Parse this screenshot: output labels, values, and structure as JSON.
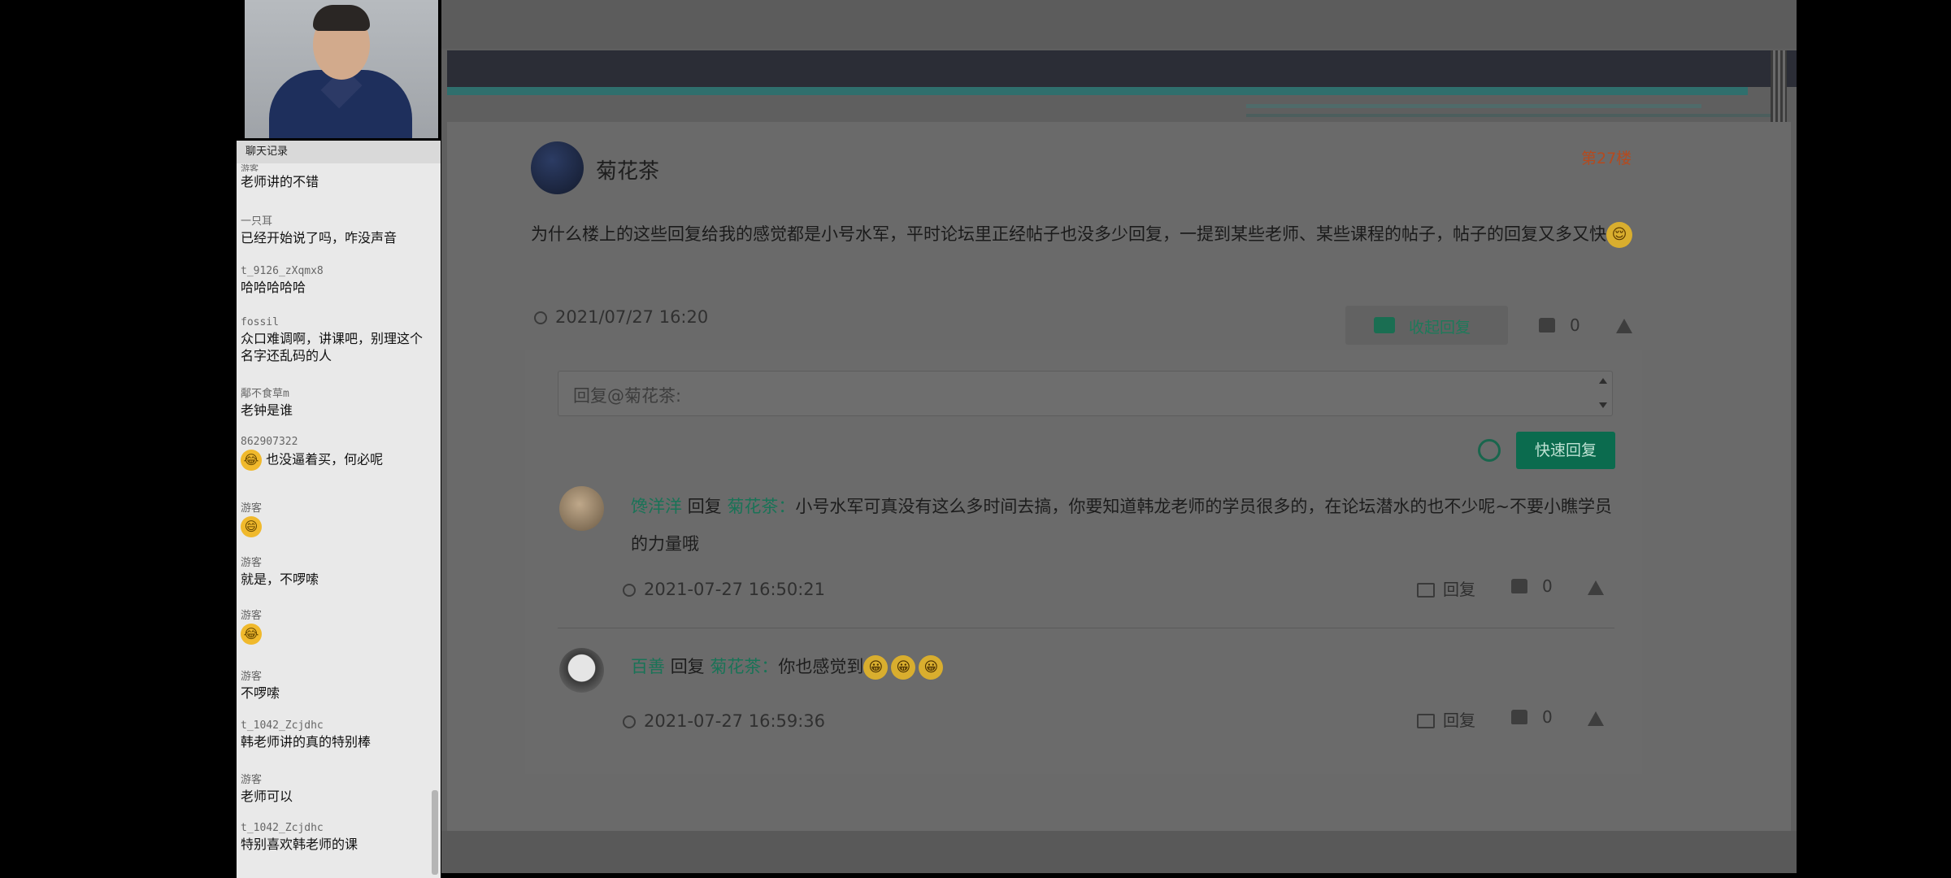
{
  "chat": {
    "title": "聊天记录",
    "messages": [
      {
        "user": "游客",
        "text": "老师讲的不错"
      },
      {
        "user": "一只耳",
        "text": "已经开始说了吗，咋没声音"
      },
      {
        "user": "t_9126_zXqmx8",
        "text": "哈哈哈哈哈"
      },
      {
        "user": "fossil",
        "text": "众口难调啊，讲课吧，别理这个名字还乱码的人"
      },
      {
        "user": "鄅不食草m",
        "text": "老钟是谁"
      },
      {
        "user": "862907322",
        "text": "也没逼着买，何必呢",
        "emoji": "😂"
      },
      {
        "user": "游客",
        "text": "",
        "emoji": "😄"
      },
      {
        "user": "游客",
        "text": "就是，不啰嗦"
      },
      {
        "user": "游客",
        "text": "",
        "emoji": "😂"
      },
      {
        "user": "游客",
        "text": "不啰嗦"
      },
      {
        "user": "t_1042_Zcjdhc",
        "text": "韩老师讲的真的特别棒"
      },
      {
        "user": "游客",
        "text": "老师可以"
      },
      {
        "user": "t_1042_Zcjdhc",
        "text": "特别喜欢韩老师的课"
      }
    ]
  },
  "post": {
    "author": "菊花茶",
    "floor": "第27楼",
    "body": "为什么楼上的这些回复给我的感觉都是小号水军，平时论坛里正经帖子也没多少回复，一提到某些老师、某些课程的帖子，帖子的回复又多又快",
    "body_emoji": "😌",
    "time": "2021/07/27 16:20",
    "collapse_label": "收起回复",
    "likes": "0"
  },
  "reply_box": {
    "placeholder": "回复@菊花茶:",
    "quick_reply_label": "快速回复"
  },
  "replies": [
    {
      "user": "馋洋洋",
      "reply_word": "回复",
      "target": "菊花茶：",
      "text": "小号水军可真没有这么多时间去搞，你要知道韩龙老师的学员很多的，在论坛潜水的也不少呢~不要小瞧学员的力量哦",
      "time": "2021-07-27 16:50:21",
      "reply_label": "回复",
      "likes": "0"
    },
    {
      "user": "百善",
      "reply_word": "回复",
      "target": "菊花茶：",
      "text": "你也感觉到",
      "emojis": [
        "😀",
        "😀",
        "😀"
      ],
      "time": "2021-07-27 16:59:36",
      "reply_label": "回复",
      "likes": "0"
    }
  ],
  "icons": {
    "clock": "clock-icon",
    "comment": "comment-icon",
    "thumb": "thumbs-up-icon",
    "report": "warning-icon",
    "emoji": "smiley-icon"
  },
  "colors": {
    "accent_green": "#0b6b4e",
    "floor_orange": "#b44a1f",
    "header_dark": "#2b2d36"
  }
}
